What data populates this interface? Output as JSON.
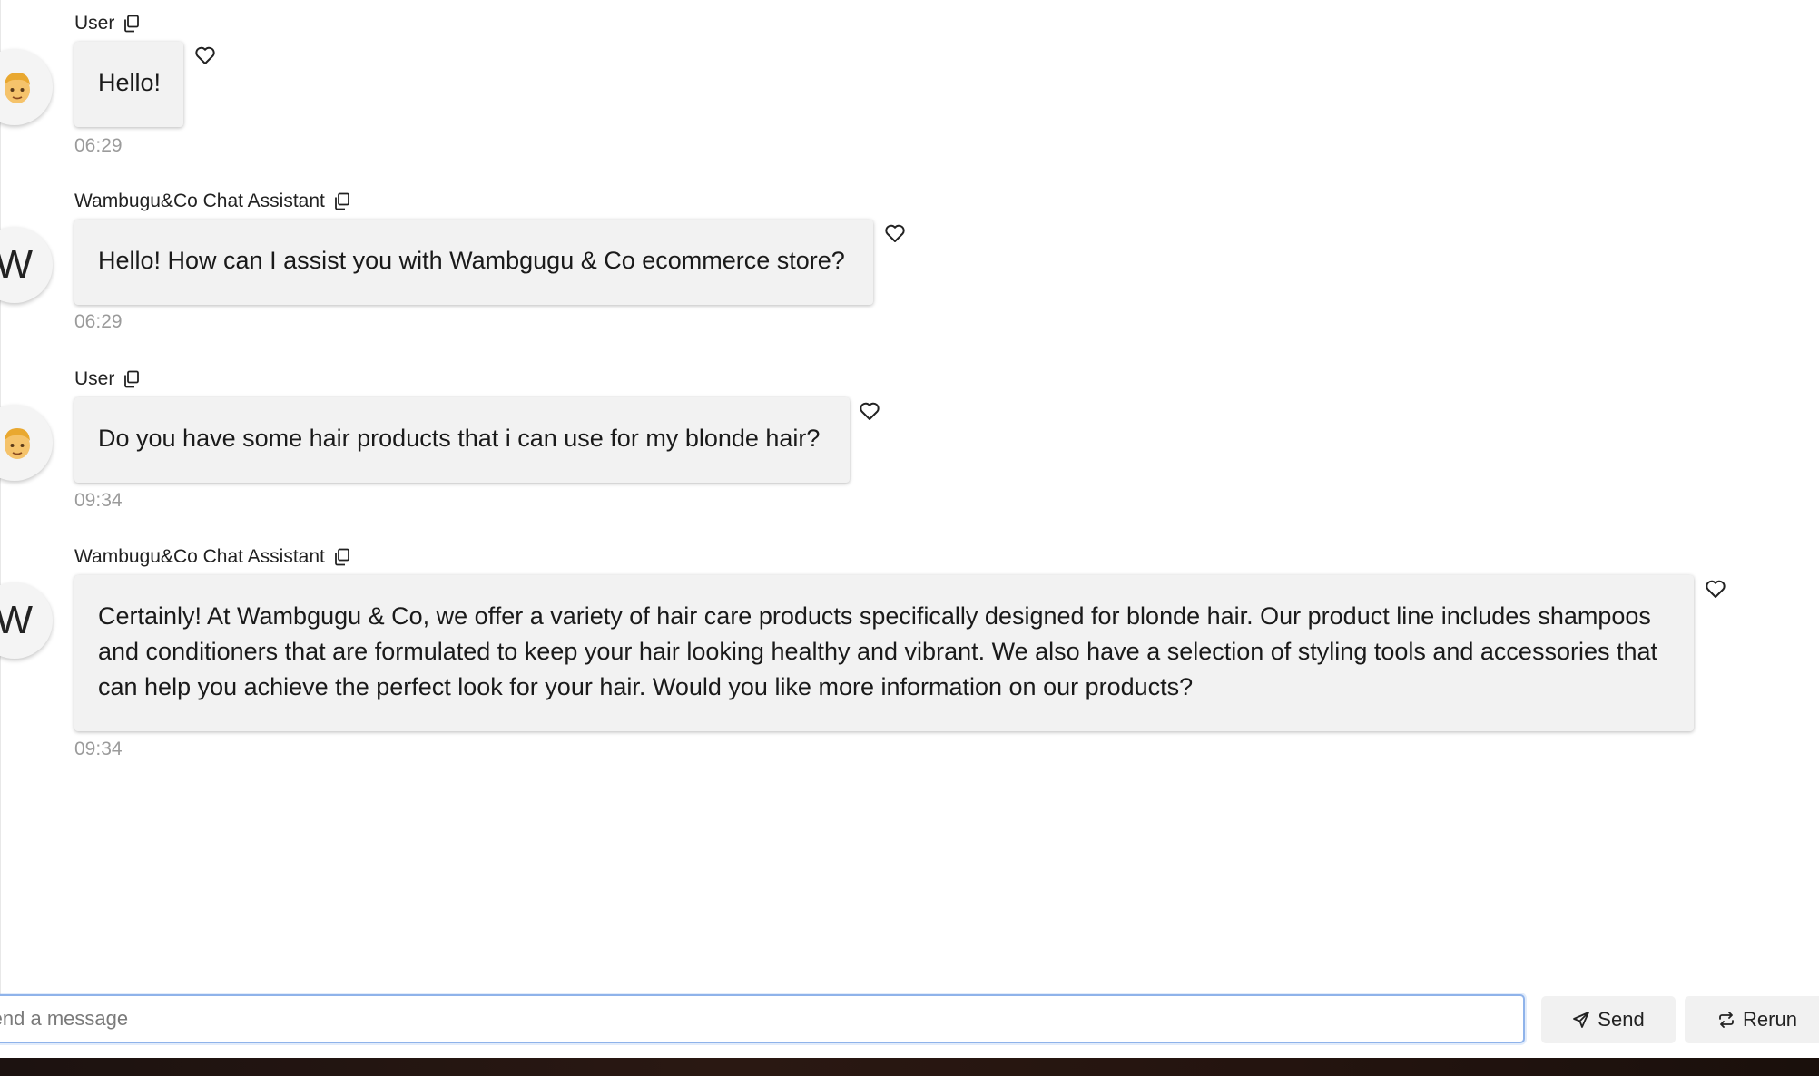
{
  "messages": [
    {
      "sender": "User",
      "avatar": "child-face-emoji",
      "text": "Hello!",
      "time": "06:29"
    },
    {
      "sender": "Wambugu&Co Chat Assistant",
      "avatar_letter": "W",
      "text": "Hello! How can I assist you with Wambgugu & Co ecommerce store?",
      "time": "06:29"
    },
    {
      "sender": "User",
      "avatar": "child-face-emoji",
      "text": "Do you have some hair products that i can use for my blonde hair?",
      "time": "09:34"
    },
    {
      "sender": "Wambugu&Co Chat Assistant",
      "avatar_letter": "W",
      "text_lines": [
        "Certainly! At Wambgugu & Co, we offer a variety of hair care products specifically designed for blonde hair. Our product line includes shampoos",
        "and conditioners that are formulated to keep your hair looking healthy and vibrant. We also have a selection of styling tools and accessories that",
        "can help you achieve the perfect look for your hair. Would you like more information on our products?"
      ],
      "time": "09:34"
    }
  ],
  "composer": {
    "placeholder": "Send a message",
    "send_label": "Send",
    "rerun_label": "Rerun"
  },
  "icons": {
    "copy": "copy-icon",
    "like": "heart-icon",
    "send": "paper-plane-icon",
    "rerun": "repeat-icon"
  },
  "colors": {
    "bubble_bg": "#f2f2f2",
    "input_border": "#8fb3ea",
    "timestamp": "#9b9b9b",
    "button_bg": "#f1f1f1"
  }
}
